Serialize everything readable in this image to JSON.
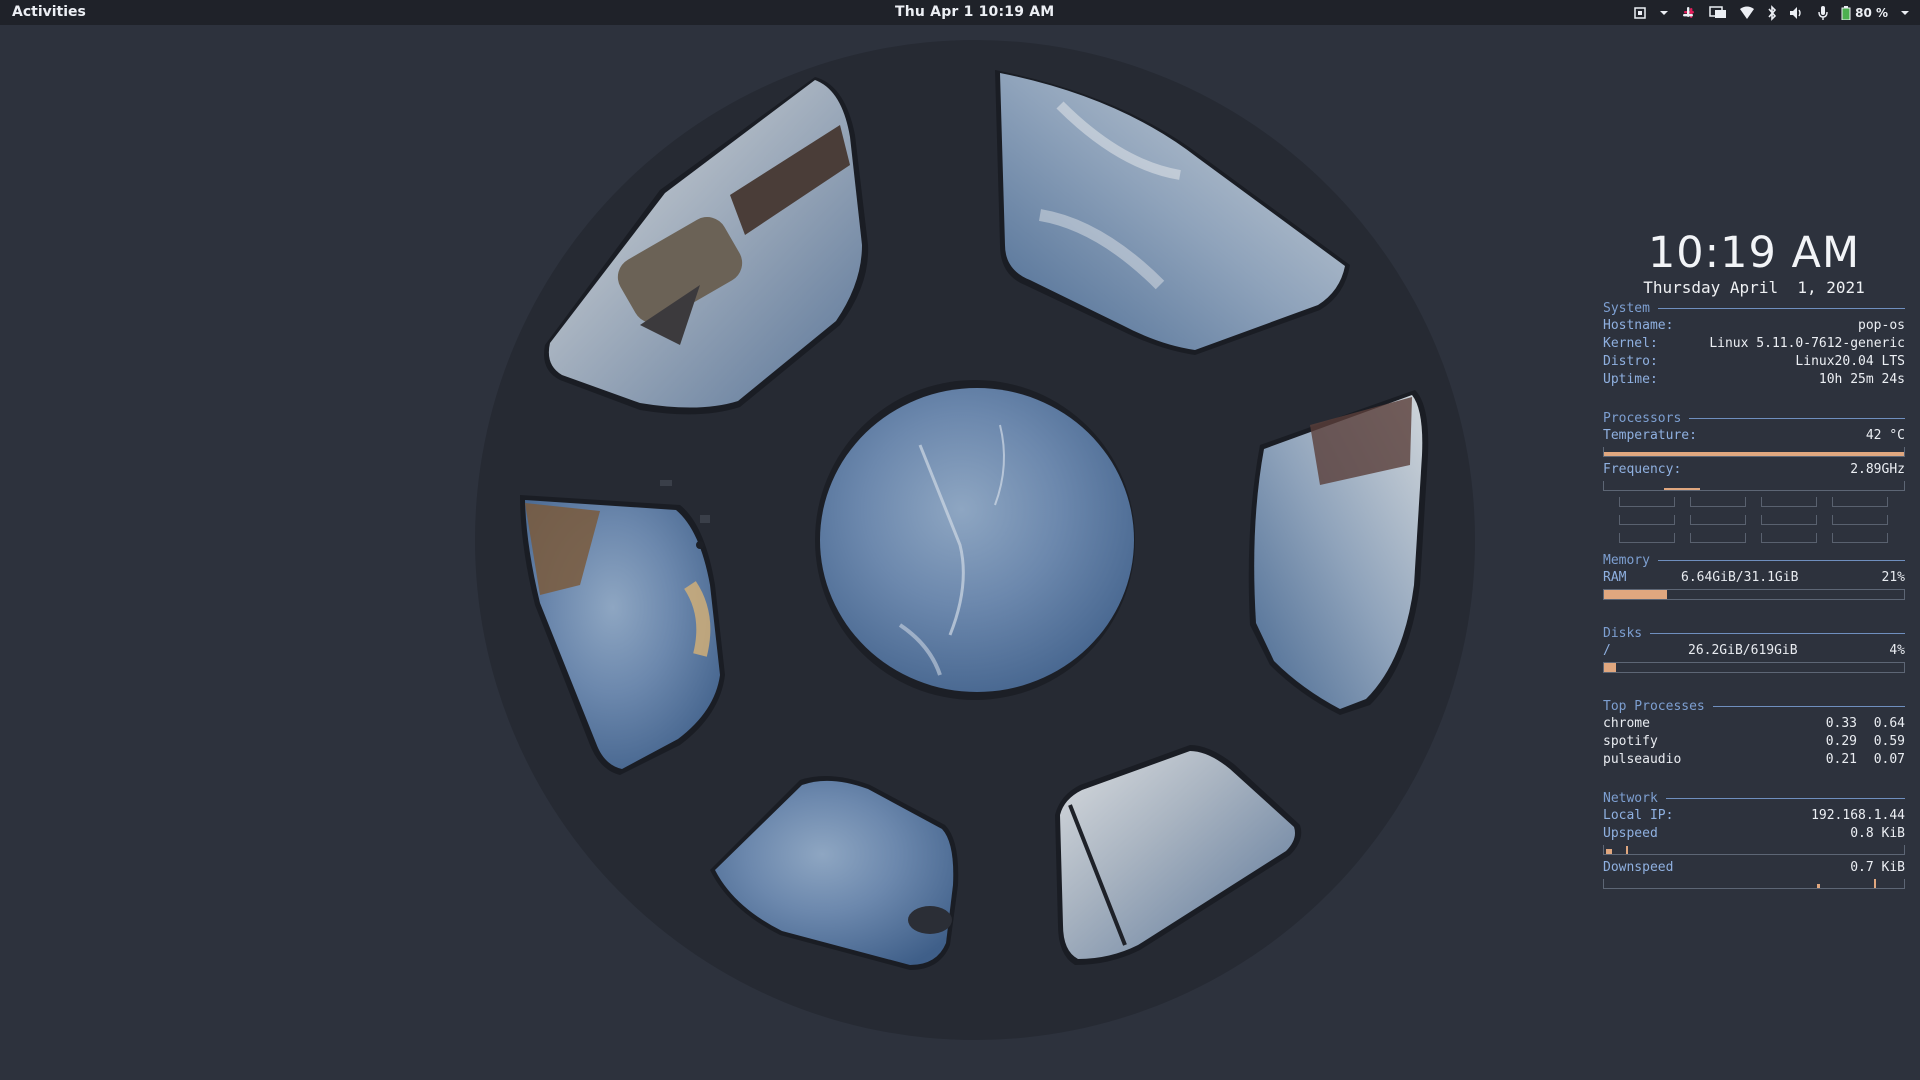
{
  "topbar": {
    "activities": "Activities",
    "clock": "Thu Apr 1  10:19 AM",
    "battery_percent": "80 %",
    "icons": [
      "screen-icon",
      "chevron-down-icon",
      "slack-icon",
      "display-icon",
      "wifi-icon",
      "bluetooth-icon",
      "volume-icon",
      "microphone-icon",
      "battery-icon",
      "chevron-down-icon"
    ]
  },
  "conky": {
    "time": "10:19 AM",
    "date": "Thursday April  1, 2021",
    "system": {
      "title": "System",
      "rows": [
        {
          "key": "Hostname:",
          "value": "pop-os"
        },
        {
          "key": "Kernel:",
          "value": "Linux 5.11.0-7612-generic"
        },
        {
          "key": "Distro:",
          "value": "Linux20.04 LTS"
        },
        {
          "key": "Uptime:",
          "value": "10h 25m 24s"
        }
      ]
    },
    "processors": {
      "title": "Processors",
      "temperature_label": "Temperature:",
      "temperature_value": "42 °C",
      "frequency_label": "Frequency:",
      "frequency_value": "2.89GHz"
    },
    "memory": {
      "title": "Memory",
      "ram_label": "RAM",
      "ram_value": "6.64GiB/31.1GiB",
      "ram_percent": "21%",
      "ram_fill": 0.21
    },
    "disks": {
      "title": "Disks",
      "mount": "/",
      "usage": "26.2GiB/619GiB",
      "percent": "4%",
      "fill": 0.04
    },
    "top_processes": {
      "title": "Top Processes",
      "rows": [
        {
          "name": "chrome",
          "cpu": "0.33",
          "mem": "0.64"
        },
        {
          "name": "spotify",
          "cpu": "0.29",
          "mem": "0.59"
        },
        {
          "name": "pulseaudio",
          "cpu": "0.21",
          "mem": "0.07"
        }
      ]
    },
    "network": {
      "title": "Network",
      "local_ip_label": "Local IP:",
      "local_ip": "192.168.1.44",
      "upspeed_label": "Upspeed",
      "upspeed": "0.8 KiB",
      "downspeed_label": "Downspeed",
      "downspeed": "0.7 KiB"
    }
  },
  "colors": {
    "accent": "#7d9fd1",
    "bar_fill": "#e0a77f",
    "background": "#2d323d",
    "topbar": "#1f2229"
  }
}
